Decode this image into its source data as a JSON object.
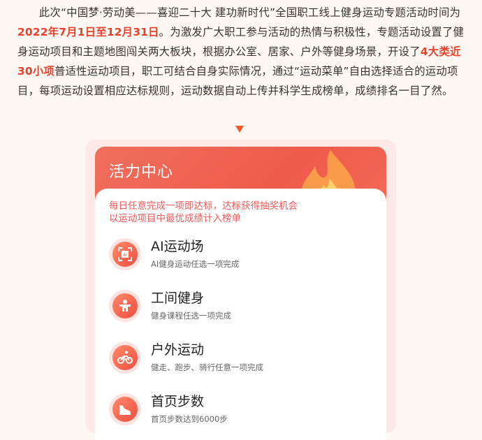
{
  "article": {
    "p1_a": "此次“中国梦·劳动美——喜迎二十大 建功新时代”全国职工线上健身运动专题活动时间为",
    "p1_date": "2022年7月1日至12月31日",
    "p1_b": "。为激发广大职工参与活动的热情与积极性，专题活动设置了健身运动项目和主题地图闯关两大板块，根据办公室、居家、户外等健身场景，开设了",
    "p1_count": "4大类近30小项",
    "p1_c": "普适性运动项目，职工可结合自身实际情况，通过“运动菜单”自由选择适合的运动项目，每项运动设置相应达标规则，运动数据自动上传并科学生成榜单，成绩排名一目了然。"
  },
  "app": {
    "header_title": "活力中心",
    "notice_line1": "每日任意完成一项即达标，达标获得抽奖机会",
    "notice_line2": "以运动项目中最优成绩计入榜单",
    "items": [
      {
        "title": "AI运动场",
        "subtitle": "AI健身运动任选一项完成",
        "icon": "ai-scan-icon"
      },
      {
        "title": "工间健身",
        "subtitle": "健身课程任选一项完成",
        "icon": "fitness-icon"
      },
      {
        "title": "户外运动",
        "subtitle": "健走、跑步、骑行任意一项完成",
        "icon": "cycling-icon"
      },
      {
        "title": "首页步数",
        "subtitle": "首页步数达到6000步",
        "icon": "shoe-icon"
      }
    ]
  },
  "colors": {
    "accent": "#ef5a4a",
    "highlight": "#e8412c",
    "notice": "#f05a5a"
  }
}
